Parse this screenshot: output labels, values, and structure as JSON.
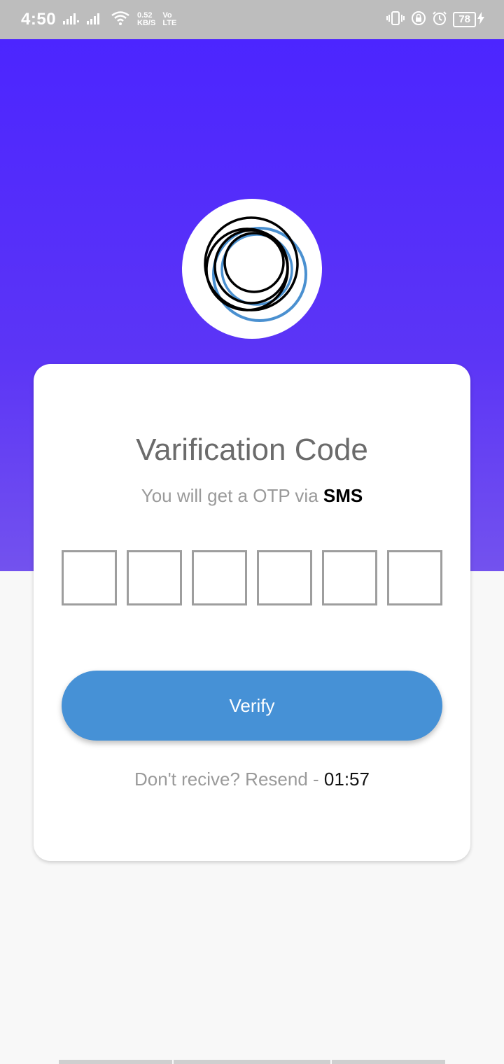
{
  "status_bar": {
    "time": "4:50",
    "speed_value": "0.52",
    "speed_unit": "KB/S",
    "net_top": "Vo",
    "net_bottom": "LTE",
    "battery": "78"
  },
  "card": {
    "title": "Varification Code",
    "subtitle_prefix": "You will get a OTP via",
    "subtitle_emphasis": "SMS",
    "otp_boxes": [
      "",
      "",
      "",
      "",
      "",
      ""
    ],
    "verify_label": "Verify",
    "resend_label": "Don't recive? Resend -",
    "resend_timer": "01:57"
  },
  "colors": {
    "hero_top": "#4c25ff",
    "hero_bottom": "#7352ee",
    "button": "#4691d6",
    "background": "#f8f8f8"
  },
  "icons": [
    "signal-icon",
    "wifi-icon",
    "vibrate-icon",
    "rotation-lock-icon",
    "alarm-icon",
    "battery-icon",
    "charging-icon",
    "app-logo-icon"
  ]
}
